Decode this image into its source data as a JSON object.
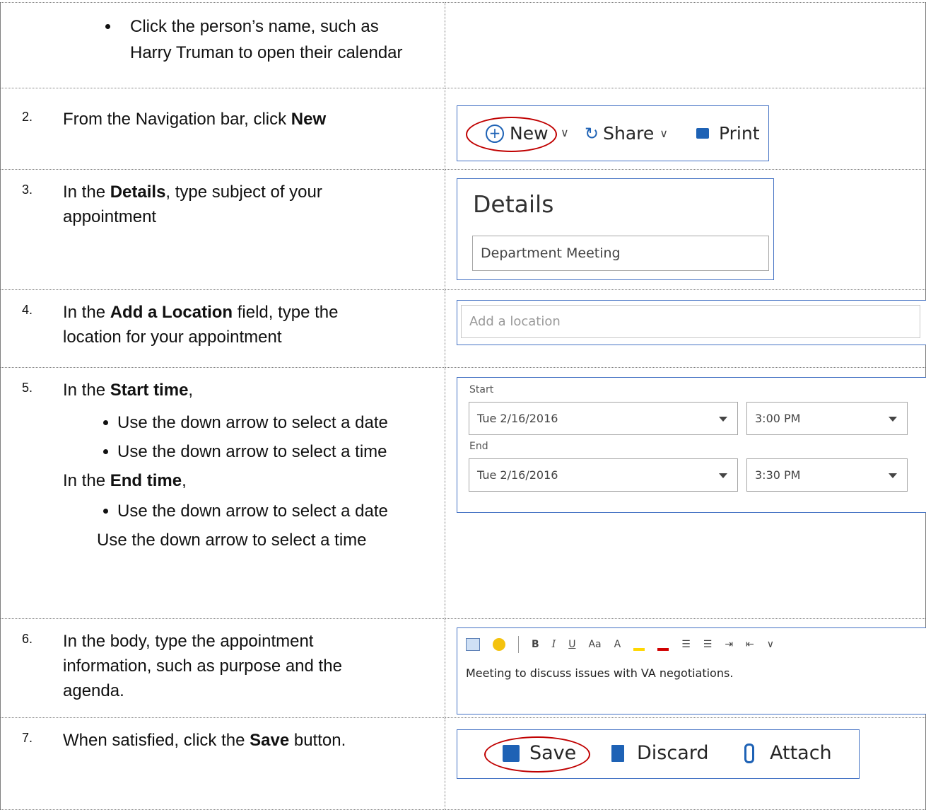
{
  "step1": {
    "bullet": "Click the person’s name, such as Harry Truman to open their calendar"
  },
  "step2": {
    "num": "2.",
    "pre": "From the Navigation bar, click ",
    "bold": "New",
    "toolbar": {
      "new": "New",
      "share": "Share",
      "print": "Print"
    }
  },
  "step3": {
    "num": "3.",
    "pre": "In the ",
    "bold": "Details",
    "post": ", type subject of your appointment",
    "panel": {
      "title": "Details",
      "value": "Department Meeting"
    }
  },
  "step4": {
    "num": "4.",
    "pre": "In the ",
    "bold": "Add a Location",
    "post": " field, type the location for your appointment",
    "placeholder": "Add a location"
  },
  "step5": {
    "num": "5.",
    "line1_pre": "In the ",
    "line1_bold": "Start time",
    "line1_post": ",",
    "bullet_date": "Use the down arrow to select a date",
    "bullet_time": "Use the down arrow to select a time",
    "line2_pre": "In the ",
    "line2_bold": "End time",
    "line2_post": ",",
    "bullet_date2": "Use the down arrow to select a date",
    "plain_time": "Use the down arrow to select a time",
    "form": {
      "start_label": "Start",
      "start_date": "Tue 2/16/2016",
      "start_time": "3:00 PM",
      "end_label": "End",
      "end_date": "Tue 2/16/2016",
      "end_time": "3:30 PM"
    }
  },
  "step6": {
    "num": "6.",
    "text": "In the body, type the appointment information, such as purpose and the agenda.",
    "editor": {
      "bold": "B",
      "italic": "I",
      "underline": "U",
      "fontsize": "Aa",
      "grow": "A",
      "body": "Meeting to discuss issues with VA negotiations."
    }
  },
  "step7": {
    "num": "7.",
    "pre": "When satisfied, click the ",
    "bold": "Save",
    "post": " button.",
    "toolbar": {
      "save": "Save",
      "discard": "Discard",
      "attach": "Attach"
    }
  },
  "colors": {
    "accent_border": "#4472c4",
    "annotation": "#c00000",
    "toolbar_icon": "#1e62b5"
  }
}
